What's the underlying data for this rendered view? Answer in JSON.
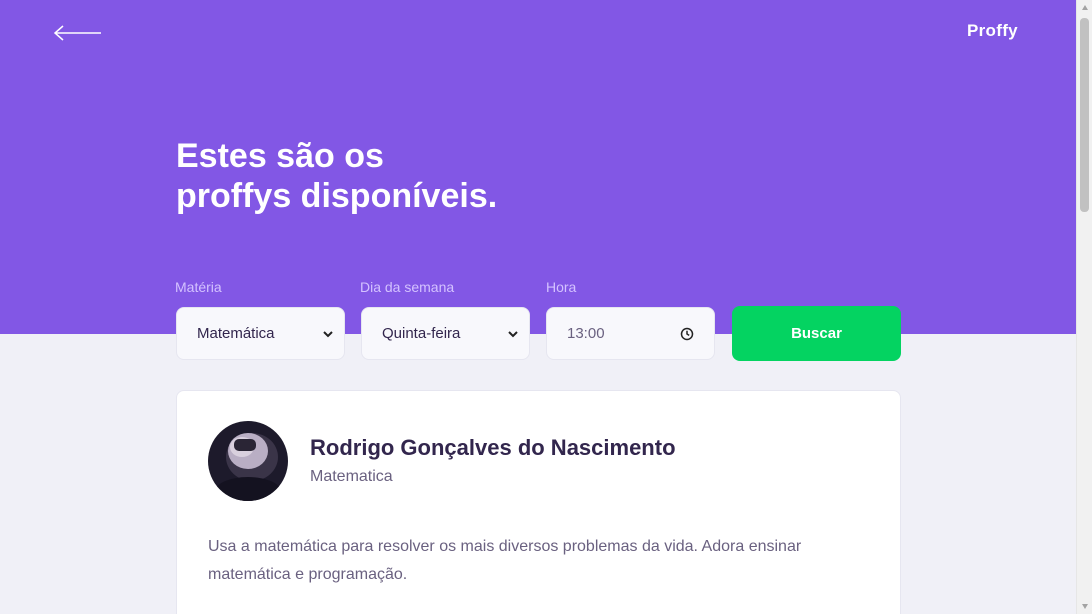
{
  "header": {
    "logo": "Proffy",
    "title_line1": "Estes são os",
    "title_line2": "proffys disponíveis."
  },
  "filters": {
    "subject": {
      "label": "Matéria",
      "value": "Matemática"
    },
    "weekday": {
      "label": "Dia da semana",
      "value": "Quinta-feira"
    },
    "time": {
      "label": "Hora",
      "value": "13:00"
    },
    "search_label": "Buscar"
  },
  "teacher": {
    "name": "Rodrigo Gonçalves do Nascimento",
    "subject": "Matematica",
    "bio": "Usa a matemática para resolver os mais diversos problemas da vida. Adora ensinar matemática e programação."
  },
  "colors": {
    "primary": "#8257e5",
    "accent": "#04d361",
    "background": "#f0f0f7"
  },
  "icons": {
    "back": "arrow-left-icon",
    "select": "chevron-down-icon",
    "time": "clock-icon"
  }
}
